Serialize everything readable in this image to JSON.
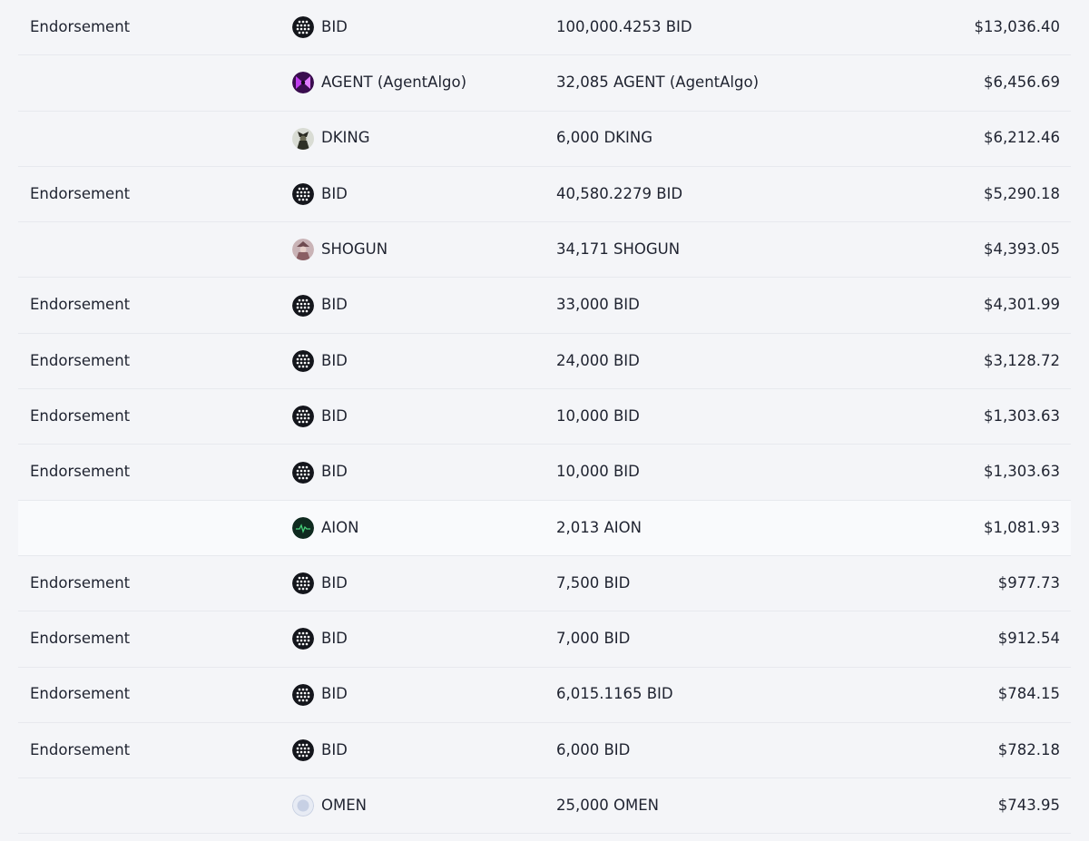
{
  "rows": [
    {
      "type": "Endorsement",
      "token": "BID",
      "icon": "bid-icon",
      "amount": "100,000.4253 BID",
      "value": "$13,036.40"
    },
    {
      "type": "",
      "token": "AGENT (AgentAlgo)",
      "icon": "agent-icon",
      "amount": "32,085 AGENT (AgentAlgo)",
      "value": "$6,456.69"
    },
    {
      "type": "",
      "token": "DKING",
      "icon": "dking-icon",
      "amount": "6,000 DKING",
      "value": "$6,212.46"
    },
    {
      "type": "Endorsement",
      "token": "BID",
      "icon": "bid-icon",
      "amount": "40,580.2279 BID",
      "value": "$5,290.18"
    },
    {
      "type": "",
      "token": "SHOGUN",
      "icon": "shogun-icon",
      "amount": "34,171 SHOGUN",
      "value": "$4,393.05"
    },
    {
      "type": "Endorsement",
      "token": "BID",
      "icon": "bid-icon",
      "amount": "33,000 BID",
      "value": "$4,301.99"
    },
    {
      "type": "Endorsement",
      "token": "BID",
      "icon": "bid-icon",
      "amount": "24,000 BID",
      "value": "$3,128.72"
    },
    {
      "type": "Endorsement",
      "token": "BID",
      "icon": "bid-icon",
      "amount": "10,000 BID",
      "value": "$1,303.63"
    },
    {
      "type": "Endorsement",
      "token": "BID",
      "icon": "bid-icon",
      "amount": "10,000 BID",
      "value": "$1,303.63"
    },
    {
      "type": "",
      "token": "AION",
      "icon": "aion-icon",
      "amount": "2,013 AION",
      "value": "$1,081.93",
      "highlight": true
    },
    {
      "type": "Endorsement",
      "token": "BID",
      "icon": "bid-icon",
      "amount": "7,500 BID",
      "value": "$977.73"
    },
    {
      "type": "Endorsement",
      "token": "BID",
      "icon": "bid-icon",
      "amount": "7,000 BID",
      "value": "$912.54"
    },
    {
      "type": "Endorsement",
      "token": "BID",
      "icon": "bid-icon",
      "amount": "6,015.1165 BID",
      "value": "$784.15"
    },
    {
      "type": "Endorsement",
      "token": "BID",
      "icon": "bid-icon",
      "amount": "6,000 BID",
      "value": "$782.18"
    },
    {
      "type": "",
      "token": "OMEN",
      "icon": "omen-icon",
      "amount": "25,000 OMEN",
      "value": "$743.95"
    }
  ]
}
